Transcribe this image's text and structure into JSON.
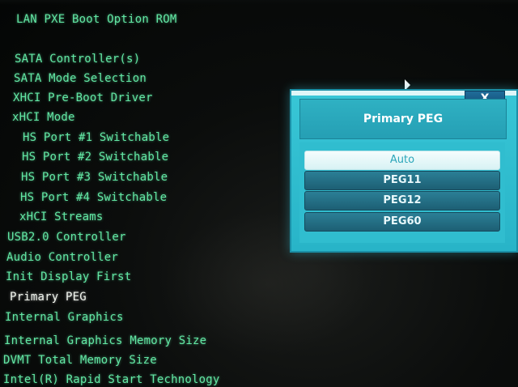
{
  "menu": {
    "items": [
      {
        "label": "LAN PXE Boot Option ROM"
      },
      {
        "label": "SATA Controller(s)"
      },
      {
        "label": "SATA Mode Selection"
      },
      {
        "label": "XHCI Pre-Boot Driver"
      },
      {
        "label": "xHCI Mode"
      },
      {
        "label": "HS Port #1 Switchable"
      },
      {
        "label": "HS Port #2 Switchable"
      },
      {
        "label": "HS Port #3 Switchable"
      },
      {
        "label": "HS Port #4 Switchable"
      },
      {
        "label": "xHCI Streams"
      },
      {
        "label": "USB2.0 Controller"
      },
      {
        "label": "Audio Controller"
      },
      {
        "label": "Init Display First"
      },
      {
        "label": "Primary PEG"
      },
      {
        "label": "Internal Graphics"
      },
      {
        "label": "Internal Graphics Memory Size"
      },
      {
        "label": "DVMT Total Memory Size"
      },
      {
        "label": "Intel(R) Rapid Start Technology"
      }
    ],
    "selected_index": 13
  },
  "popup": {
    "title": "Primary PEG",
    "close_label": "X",
    "options": [
      {
        "label": "Auto"
      },
      {
        "label": "PEG11"
      },
      {
        "label": "PEG12"
      },
      {
        "label": "PEG60"
      }
    ],
    "highlighted_index": 0
  },
  "colors": {
    "menu_text": "#62e7a4",
    "selected_text": "#f2f7ef",
    "popup_bg": "#30bdcf",
    "option_bg": "#1d5f74"
  }
}
